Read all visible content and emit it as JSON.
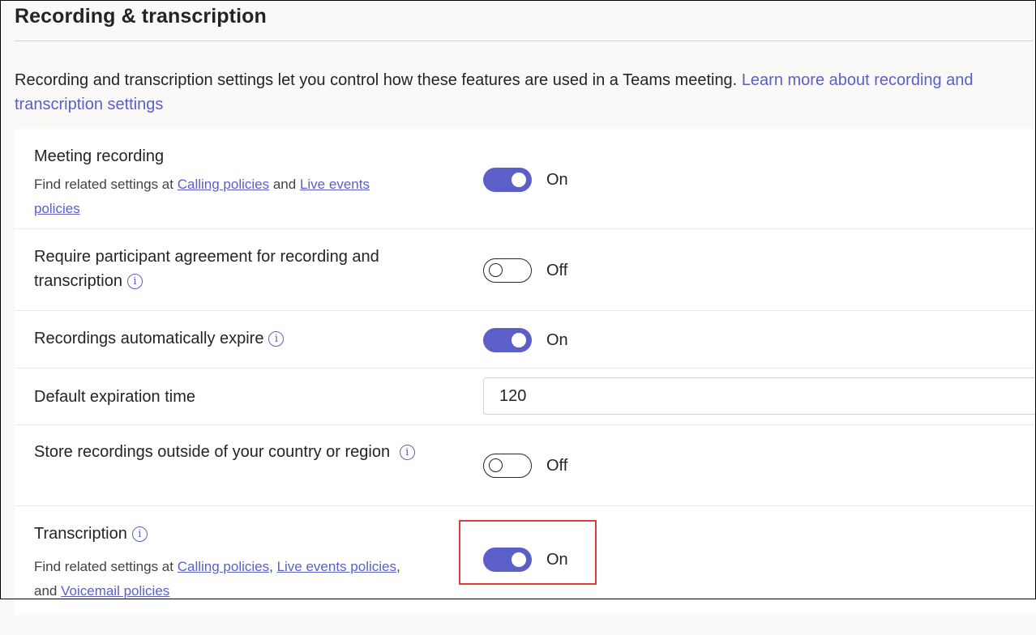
{
  "header": {
    "title": "Recording & transcription"
  },
  "description": {
    "text": "Recording and transcription settings let you control how these features are used in a Teams meeting.",
    "link": "Learn more about recording and transcription settings"
  },
  "settings": {
    "meeting_recording": {
      "label": "Meeting recording",
      "sub_prefix": "Find related settings at",
      "link1": "Calling policies",
      "sub_and": "and",
      "link2": "Live events policies",
      "state": "On"
    },
    "participant_agreement": {
      "label": "Require participant agreement for recording and transcription",
      "state": "Off"
    },
    "auto_expire": {
      "label": "Recordings automatically expire",
      "state": "On"
    },
    "default_expiration": {
      "label": "Default expiration time",
      "value": "120"
    },
    "store_outside": {
      "label": "Store recordings outside of your country or region",
      "state": "Off"
    },
    "transcription": {
      "label": "Transcription",
      "sub_prefix": "Find related settings at",
      "link1": "Calling policies",
      "link2": "Live events policies",
      "sub_and": "and",
      "link3": "Voicemail policies",
      "state": "On"
    }
  },
  "info_glyph": "i",
  "colors": {
    "accent": "#5b5fc7",
    "highlight": "#e0393e"
  }
}
